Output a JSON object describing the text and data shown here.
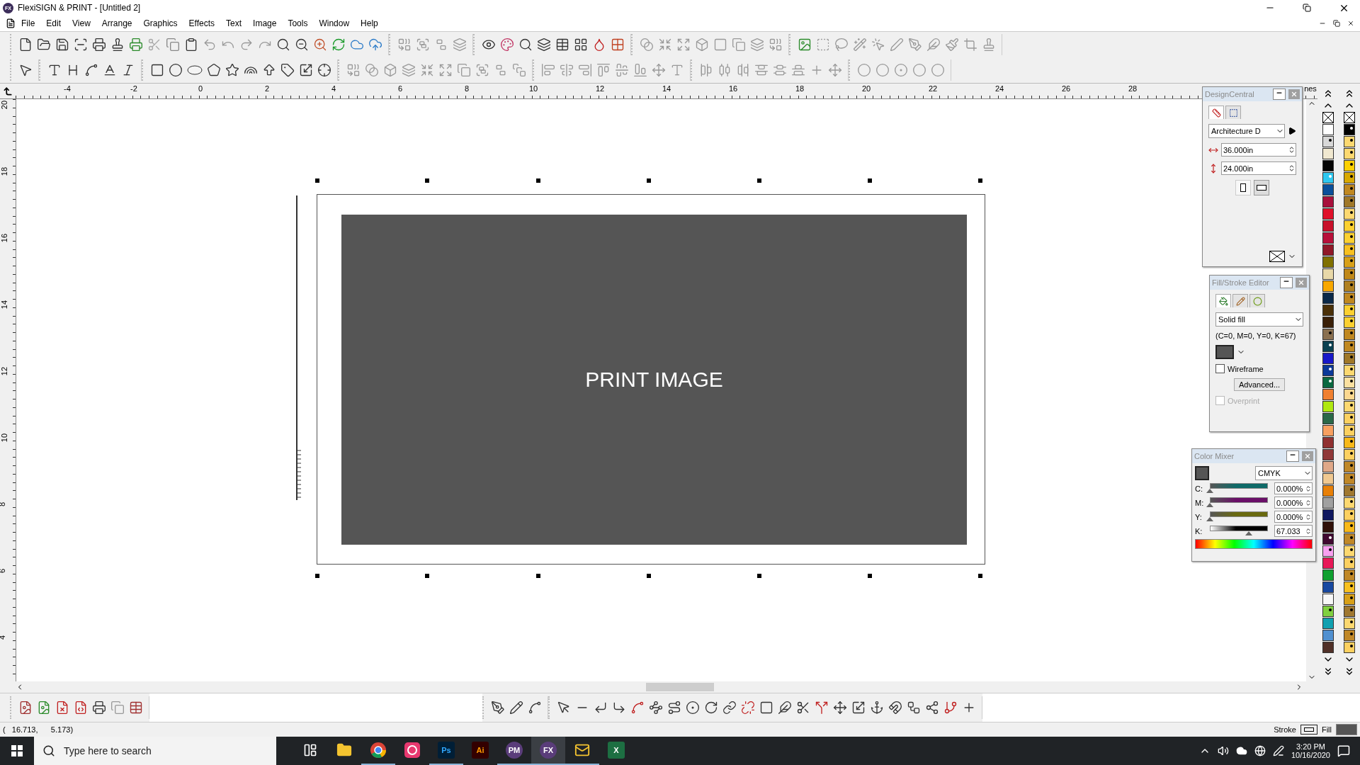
{
  "window": {
    "logo": "FX",
    "title": "FlexiSIGN & PRINT - [Untitled 2]"
  },
  "menu": [
    {
      "label": "File"
    },
    {
      "label": "Edit"
    },
    {
      "label": "View"
    },
    {
      "label": "Arrange"
    },
    {
      "label": "Graphics"
    },
    {
      "label": "Effects"
    },
    {
      "label": "Text"
    },
    {
      "label": "Image"
    },
    {
      "label": "Tools"
    },
    {
      "label": "Window"
    },
    {
      "label": "Help"
    }
  ],
  "ruler": {
    "x_labels": [
      "-4",
      "-2",
      "0",
      "2",
      "4",
      "6",
      "8",
      "10",
      "12",
      "14",
      "16",
      "18",
      "20",
      "22",
      "24",
      "26",
      "28"
    ],
    "y_labels": [
      "20",
      "18",
      "16",
      "14",
      "12",
      "10",
      "8",
      "6",
      "4"
    ],
    "units": "nes"
  },
  "canvas": {
    "image_label": "PRINT IMAGE"
  },
  "design_central": {
    "title": "DesignCentral",
    "tabs": [
      {
        "selected": true
      },
      {
        "selected": false
      }
    ],
    "page_size": "Architecture D",
    "width": "36.000in",
    "height": "24.000in",
    "orientation": [
      {
        "selected": false
      },
      {
        "selected": true
      }
    ]
  },
  "fill_stroke": {
    "title": "Fill/Stroke Editor",
    "tabs": [
      {
        "selected": true
      },
      {
        "selected": false
      },
      {
        "selected": false
      }
    ],
    "fill_type": "Solid fill",
    "color_values": "(C=0, M=0, Y=0, K=67)",
    "wireframe": {
      "label": "Wireframe",
      "checked": false,
      "disabled": false
    },
    "advanced_button": "Advanced...",
    "overprint": {
      "label": "Overprint",
      "checked": false,
      "disabled": true
    }
  },
  "color_mixer": {
    "title": "Color Mixer",
    "model": "CMYK",
    "channels": [
      {
        "label": "C:",
        "level": 0,
        "reading": "0.000%",
        "color": "#0f6a68"
      },
      {
        "label": "M:",
        "level": 0,
        "reading": "0.000%",
        "color": "#6a0f68"
      },
      {
        "label": "Y:",
        "level": 0,
        "reading": "0.000%",
        "color": "#6a6a0f"
      },
      {
        "label": "K:",
        "level": 0.67,
        "reading": "67.033",
        "color": "#000000"
      }
    ]
  },
  "palettes": [
    {
      "swatches": [
        {
          "color": "#ffffff",
          "marked": false
        },
        {
          "color": "#d8d8d8",
          "marked": true
        },
        {
          "color": "#f0e8d0",
          "marked": false
        },
        {
          "color": "#050505",
          "marked": false
        },
        {
          "color": "#2ec8f0",
          "marked": true
        },
        {
          "color": "#0a4f9a",
          "marked": false
        },
        {
          "color": "#a8103c",
          "marked": false
        },
        {
          "color": "#e0102a",
          "marked": false
        },
        {
          "color": "#c8102a",
          "marked": false
        },
        {
          "color": "#b8103a",
          "marked": false
        },
        {
          "color": "#901828",
          "marked": false
        },
        {
          "color": "#807000",
          "marked": false
        },
        {
          "color": "#e8d8a8",
          "marked": false
        },
        {
          "color": "#f8a800",
          "marked": false
        },
        {
          "color": "#0a2848",
          "marked": false
        },
        {
          "color": "#4a3008",
          "marked": false
        },
        {
          "color": "#3a2008",
          "marked": false
        },
        {
          "color": "#8a7050",
          "marked": true
        },
        {
          "color": "#0a4050",
          "marked": true
        },
        {
          "color": "#1818c8",
          "marked": false
        },
        {
          "color": "#0a3898",
          "marked": true
        },
        {
          "color": "#0a6840",
          "marked": true
        },
        {
          "color": "#f08030",
          "marked": false
        },
        {
          "color": "#b0e810",
          "marked": false
        },
        {
          "color": "#2a6848",
          "marked": false
        },
        {
          "color": "#f8a060",
          "marked": false
        },
        {
          "color": "#903030",
          "marked": false
        },
        {
          "color": "#903838",
          "marked": false
        },
        {
          "color": "#e0a888",
          "marked": false
        },
        {
          "color": "#f0c890",
          "marked": false
        },
        {
          "color": "#e88008",
          "marked": false
        },
        {
          "color": "#a0a0a0",
          "marked": false
        },
        {
          "color": "#101860",
          "marked": false
        },
        {
          "color": "#301008",
          "marked": false
        },
        {
          "color": "#400830",
          "marked": true
        },
        {
          "color": "#f8a0f0",
          "marked": true
        },
        {
          "color": "#e81858",
          "marked": false
        },
        {
          "color": "#10a030",
          "marked": false
        },
        {
          "color": "#1848a0",
          "marked": false
        },
        {
          "color": "#f8f8f8",
          "marked": false
        },
        {
          "color": "#80d040",
          "marked": true
        },
        {
          "color": "#10a0b0",
          "marked": false
        },
        {
          "color": "#5090d0",
          "marked": false
        },
        {
          "color": "#503028",
          "marked": false
        }
      ]
    },
    {
      "swatches": [
        {
          "color": "#000000",
          "marked": true
        },
        {
          "color": "#fcd870",
          "marked": true
        },
        {
          "color": "#fcd870",
          "marked": true
        },
        {
          "color": "#fcd000",
          "marked": true
        },
        {
          "color": "#d8a800",
          "marked": true
        },
        {
          "color": "#c08820",
          "marked": true
        },
        {
          "color": "#a07828",
          "marked": true
        },
        {
          "color": "#fcd870",
          "marked": true
        },
        {
          "color": "#fcd030",
          "marked": true
        },
        {
          "color": "#fcd030",
          "marked": true
        },
        {
          "color": "#f8c020",
          "marked": true
        },
        {
          "color": "#d8a018",
          "marked": true
        },
        {
          "color": "#c08818",
          "marked": true
        },
        {
          "color": "#b08020",
          "marked": true
        },
        {
          "color": "#c08820",
          "marked": true
        },
        {
          "color": "#fcd030",
          "marked": true
        },
        {
          "color": "#fcd030",
          "marked": true
        },
        {
          "color": "#c08820",
          "marked": true
        },
        {
          "color": "#c08820",
          "marked": true
        },
        {
          "color": "#a07828",
          "marked": true
        },
        {
          "color": "#fcd870",
          "marked": true
        },
        {
          "color": "#fce0a0",
          "marked": true
        },
        {
          "color": "#fcd890",
          "marked": true
        },
        {
          "color": "#fcd870",
          "marked": true
        },
        {
          "color": "#fcd060",
          "marked": true
        },
        {
          "color": "#fcd060",
          "marked": true
        },
        {
          "color": "#f8b818",
          "marked": true
        },
        {
          "color": "#fcd060",
          "marked": true
        },
        {
          "color": "#c08828",
          "marked": true
        },
        {
          "color": "#c08828",
          "marked": true
        },
        {
          "color": "#a07830",
          "marked": true
        },
        {
          "color": "#fcd870",
          "marked": true
        },
        {
          "color": "#fcd060",
          "marked": true
        },
        {
          "color": "#f8b818",
          "marked": true
        },
        {
          "color": "#c08828",
          "marked": true
        },
        {
          "color": "#fcd870",
          "marked": true
        },
        {
          "color": "#fcd060",
          "marked": true
        },
        {
          "color": "#c08828",
          "marked": true
        },
        {
          "color": "#f8c020",
          "marked": true
        },
        {
          "color": "#d8a018",
          "marked": true
        },
        {
          "color": "#a07830",
          "marked": true
        },
        {
          "color": "#fcd870",
          "marked": true
        },
        {
          "color": "#c08828",
          "marked": true
        },
        {
          "color": "#fcd060",
          "marked": true
        }
      ]
    }
  ],
  "status_bar": {
    "coordinates": "(   16.713,      5.173)",
    "stroke_label": "Stroke",
    "fill_label": "Fill"
  },
  "taskbar": {
    "search_placeholder": "Type here to search",
    "time": "3:20 PM",
    "date": "10/16/2020",
    "apps": [
      {
        "kind": "taskview",
        "running": false,
        "active": false
      },
      {
        "kind": "folder",
        "running": false,
        "active": false
      },
      {
        "kind": "chrome",
        "running": true,
        "active": false
      },
      {
        "kind": "cloud",
        "running": false,
        "active": false
      },
      {
        "kind": "ps",
        "label": "Ps",
        "running": true,
        "active": false
      },
      {
        "kind": "ai",
        "label": "Ai",
        "running": false,
        "active": false
      },
      {
        "kind": "round",
        "label": "PM",
        "running": true,
        "active": false
      },
      {
        "kind": "round",
        "label": "FX",
        "running": true,
        "active": true
      },
      {
        "kind": "mail",
        "running": true,
        "active": false
      },
      {
        "kind": "excel",
        "label": "X",
        "running": false,
        "active": false
      }
    ]
  }
}
